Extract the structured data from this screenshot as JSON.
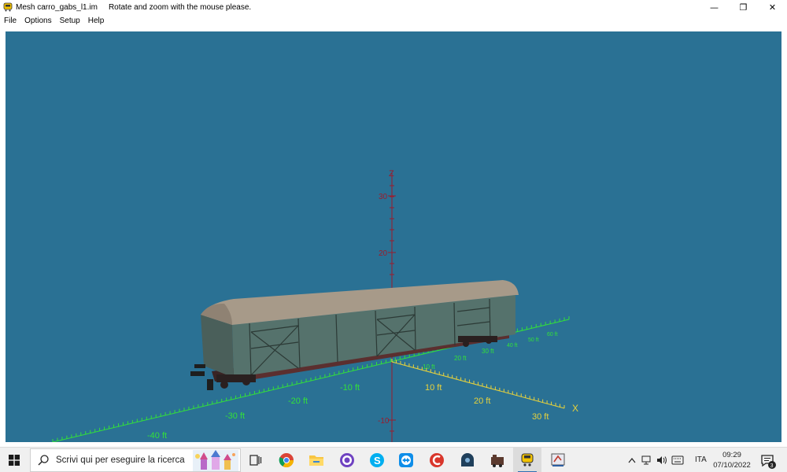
{
  "window": {
    "title": "Mesh carro_gabs_l1.im",
    "message": "Rotate and zoom with the mouse please.",
    "minimize_glyph": "—",
    "restore_glyph": "❐",
    "close_glyph": "✕"
  },
  "menu": {
    "items": [
      "File",
      "Options",
      "Setup",
      "Help"
    ]
  },
  "viewport": {
    "background": "#2a7194",
    "axis_labels": {
      "x": "X",
      "z": "Z"
    },
    "z_ticks": [
      "30",
      "20",
      "10"
    ],
    "z_neg_tick": "-10",
    "y_neg_ticks": [
      "-10 ft",
      "-20 ft",
      "-30 ft",
      "-40 ft"
    ],
    "x_ticks": [
      "10 ft",
      "20 ft",
      "30 ft"
    ],
    "y_pos_ticks": [
      "10 ft",
      "20 ft",
      "30 ft",
      "40 ft",
      "50 ft",
      "60 ft"
    ],
    "colors": {
      "axis_red": "#9b1c2c",
      "axis_green": "#33e03a",
      "axis_yellow": "#e7d23c"
    }
  },
  "taskbar": {
    "search_placeholder": "Scrivi qui per eseguire la ricerca",
    "language": "ITA",
    "time": "09:29",
    "date": "07/10/2022",
    "notification_count": "3"
  }
}
